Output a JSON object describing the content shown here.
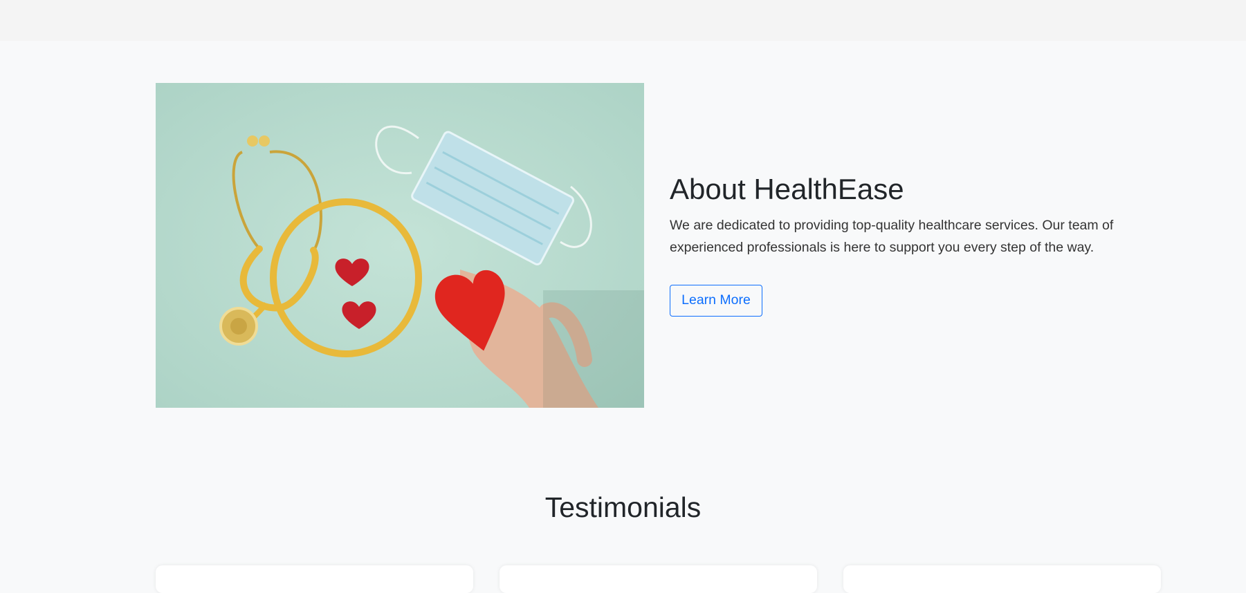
{
  "about": {
    "title": "About HealthEase",
    "description": "We are dedicated to providing top-quality healthcare services. Our team of experienced professionals is here to support you every step of the way.",
    "learn_more_label": "Learn More",
    "image_description": "stethoscope, face mask, hearts"
  },
  "testimonials": {
    "title": "Testimonials",
    "cards_visible": 3
  },
  "colors": {
    "page_background": "#f8f9fa",
    "accent": "#0d6efd",
    "image_background": "#b4d8cd"
  }
}
